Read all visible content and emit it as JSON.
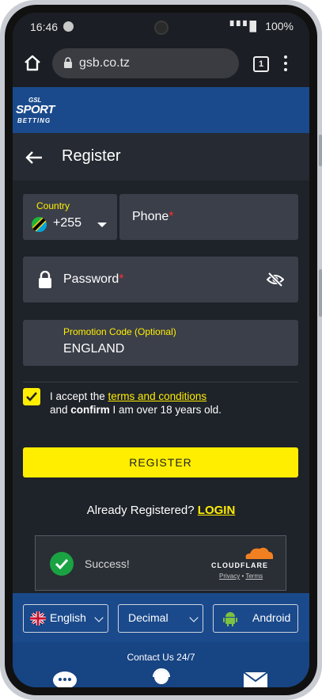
{
  "status_bar": {
    "time": "16:46",
    "signal": "▘▘▘█",
    "battery": "100%"
  },
  "browser": {
    "url": "gsb.co.tz",
    "tab_count": "1"
  },
  "site": {
    "logo_top": "GSL",
    "logo_main": "SPORT",
    "logo_bottom": "BETTING"
  },
  "page": {
    "title": "Register"
  },
  "form": {
    "country_label": "Country",
    "country_code": "+255",
    "phone_label": "Phone",
    "password_label": "Password",
    "required_mark": "*",
    "promo_label": "Promotion Code (Optional)",
    "promo_value": "ENGLAND",
    "accept_prefix": "I accept the ",
    "terms_link": "terms and conditions",
    "and_text": "and ",
    "confirm_text": "confirm",
    "age_text": " I am over 18 years old.",
    "register_button": "REGISTER",
    "already_text": "Already Registered? ",
    "login_link": "LOGIN"
  },
  "captcha": {
    "status": "Success!",
    "brand": "CLOUDFLARE",
    "privacy": "Privacy",
    "sep": " • ",
    "terms": "Terms"
  },
  "bottom_bar": {
    "language": "English",
    "odds_format": "Decimal",
    "app": "Android",
    "contact": "Contact Us 24/7"
  },
  "colors": {
    "accent": "#ffee00",
    "brand_blue": "#1a4a8c",
    "background": "#1e2229",
    "field": "#3b3f4a",
    "required": "#ff2d2d",
    "success": "#1aa342"
  }
}
